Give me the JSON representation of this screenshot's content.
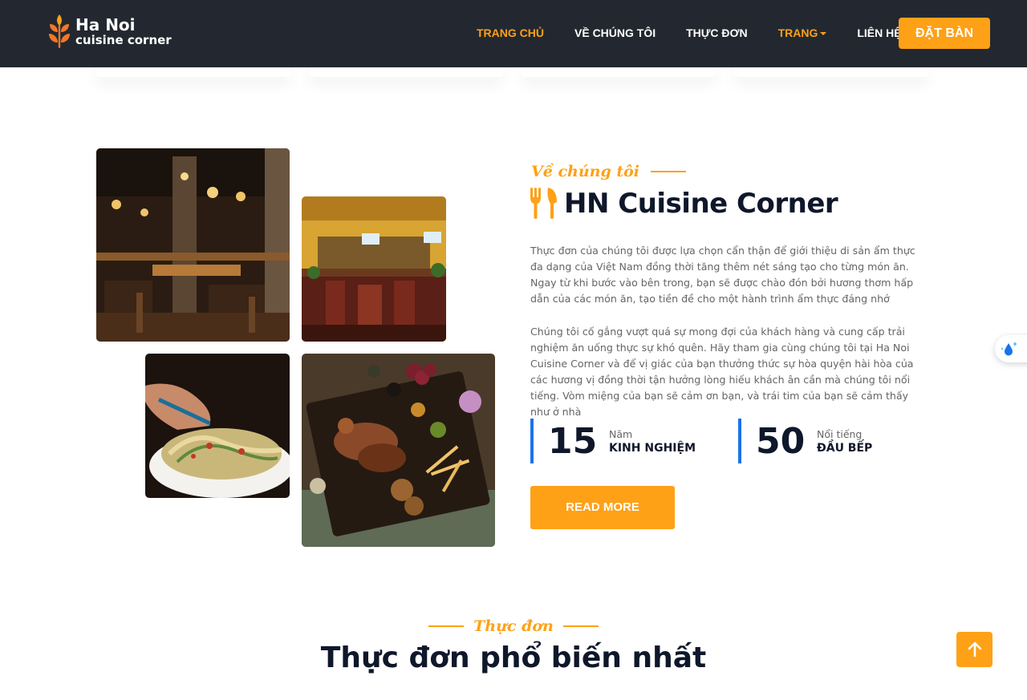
{
  "brand": {
    "line1": "Ha Noi",
    "line2": "cuisine corner",
    "accent": "#FEA116",
    "nav_bg": "#232830",
    "logo_icon": "wheat-icon"
  },
  "nav": {
    "items": [
      {
        "label": "TRANG CHỦ",
        "active": true
      },
      {
        "label": "VỀ CHÚNG TÔI",
        "active": false
      },
      {
        "label": "THỰC ĐƠN",
        "active": false
      },
      {
        "label": "TRANG",
        "active": false,
        "dropdown": true
      },
      {
        "label": "LIÊN HỆ",
        "active": false
      }
    ],
    "cta": "ĐẶT BÀN"
  },
  "about": {
    "subtitle": "Về chúng tôi",
    "title": "HN Cuisine Corner",
    "title_icon": "utensils-icon",
    "para1": "Thực đơn của chúng tôi được lựa chọn cẩn thận để giới thiệu di sản ẩm thực đa dạng của Việt Nam đồng thời tăng thêm nét sáng tạo cho từng món ăn. Ngay từ khi bước vào bên trong, bạn sẽ được chào đón bởi hương thơm hấp dẫn của các món ăn, tạo tiền đề cho một hành trình ẩm thực đáng nhớ",
    "para2": "Chúng tôi cố gắng vượt quá sự mong đợi của khách hàng và cung cấp trải nghiệm ăn uống thực sự khó quên. Hãy tham gia cùng chúng tôi tại Ha Noi Cuisine Corner và để vị giác của bạn thưởng thức sự hòa quyện hài hòa của các hương vị đồng thời tận hưởng lòng hiếu khách ân cần mà chúng tôi nổi tiếng. Vòm miệng của bạn sẽ cảm ơn bạn, và trái tim của bạn sẽ cảm thấy như ở nhà",
    "stats": [
      {
        "number": "15",
        "small": "Năm",
        "big": "KINH NGHIỆM"
      },
      {
        "number": "50",
        "small": "Nổi tiếng",
        "big": "ĐẦU BẾP"
      }
    ],
    "cta": "READ MORE"
  },
  "menu": {
    "subtitle": "Thực đơn",
    "title": "Thực đơn phổ biến nhất"
  }
}
